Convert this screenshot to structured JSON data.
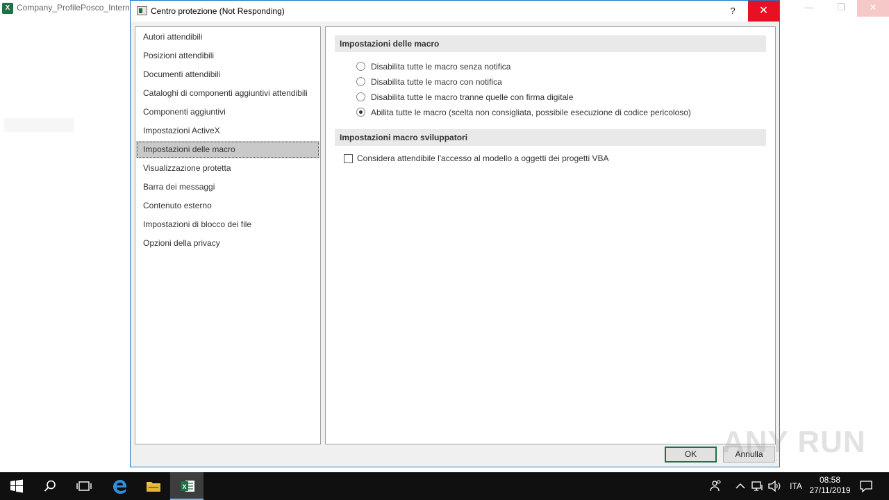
{
  "background_window": {
    "title": "Company_ProfilePosco_Internt"
  },
  "dialog": {
    "title": "Centro protezione (Not Responding)",
    "help_label": "?",
    "close_label": "✕"
  },
  "nav": {
    "items": [
      {
        "label": "Autori attendibili"
      },
      {
        "label": "Posizioni attendibili"
      },
      {
        "label": "Documenti attendibili"
      },
      {
        "label": "Cataloghi di componenti aggiuntivi attendibili"
      },
      {
        "label": "Componenti aggiuntivi"
      },
      {
        "label": "Impostazioni ActiveX"
      },
      {
        "label": "Impostazioni delle macro"
      },
      {
        "label": "Visualizzazione protetta"
      },
      {
        "label": "Barra dei messaggi"
      },
      {
        "label": "Contenuto esterno"
      },
      {
        "label": "Impostazioni di blocco dei file"
      },
      {
        "label": "Opzioni della privacy"
      }
    ],
    "selected": "Impostazioni delle macro"
  },
  "macro_settings": {
    "header": "Impostazioni delle macro",
    "options": [
      {
        "label": "Disabilita tutte le macro senza notifica",
        "checked": false
      },
      {
        "label": "Disabilita tutte le macro con notifica",
        "checked": false
      },
      {
        "label": "Disabilita tutte le macro tranne quelle con firma digitale",
        "checked": false
      },
      {
        "label": "Abilita tutte le macro (scelta non consigliata, possibile esecuzione di codice pericoloso)",
        "checked": true
      }
    ]
  },
  "developer_settings": {
    "header": "Impostazioni macro sviluppatori",
    "trust_vba_label": "Considera attendibile l'accesso al modello a oggetti dei progetti VBA",
    "trust_vba_checked": false
  },
  "buttons": {
    "ok_label": "OK",
    "cancel_label": "Annulla"
  },
  "watermark": {
    "text": "ANY RUN"
  },
  "taskbar": {
    "language": "ITA",
    "time": "08:58",
    "date": "27/11/2019"
  },
  "colors": {
    "close_red": "#e81123",
    "excel_green": "#1e7145",
    "dialog_border": "#1a78c8",
    "taskbar_bg": "#101010"
  }
}
